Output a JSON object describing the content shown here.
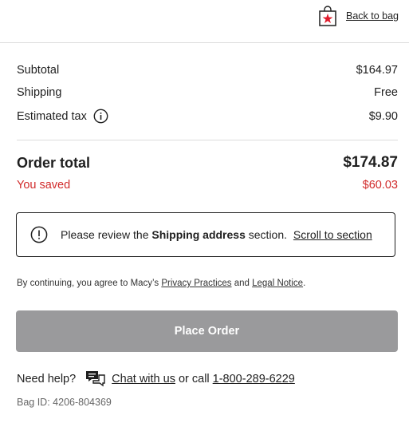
{
  "header": {
    "back_to_bag": "Back to bag",
    "bag_icon": "shopping-bag-star-icon"
  },
  "summary": {
    "subtotal_label": "Subtotal",
    "subtotal_value": "$164.97",
    "shipping_label": "Shipping",
    "shipping_value": "Free",
    "tax_label": "Estimated tax",
    "tax_value": "$9.90",
    "order_total_label": "Order total",
    "order_total_value": "$174.87",
    "saved_label": "You saved",
    "saved_value": "$60.03"
  },
  "notice": {
    "prefix": "Please review the",
    "section": "Shipping address",
    "suffix": "section.",
    "link": "Scroll to section"
  },
  "terms": {
    "prefix": "By continuing, you agree to Macy’s",
    "privacy": "Privacy Practices",
    "and": "and",
    "legal": "Legal Notice",
    "end": "."
  },
  "place_order": "Place Order",
  "help": {
    "label": "Need help?",
    "chat": "Chat with us",
    "or_call": "or call",
    "phone": "1-800-289-6229"
  },
  "bag_id": "Bag ID: 4206-804369",
  "colors": {
    "saved_red": "#d12b2b",
    "button_gray": "#9a9a9c",
    "text": "#1f1f1f"
  }
}
